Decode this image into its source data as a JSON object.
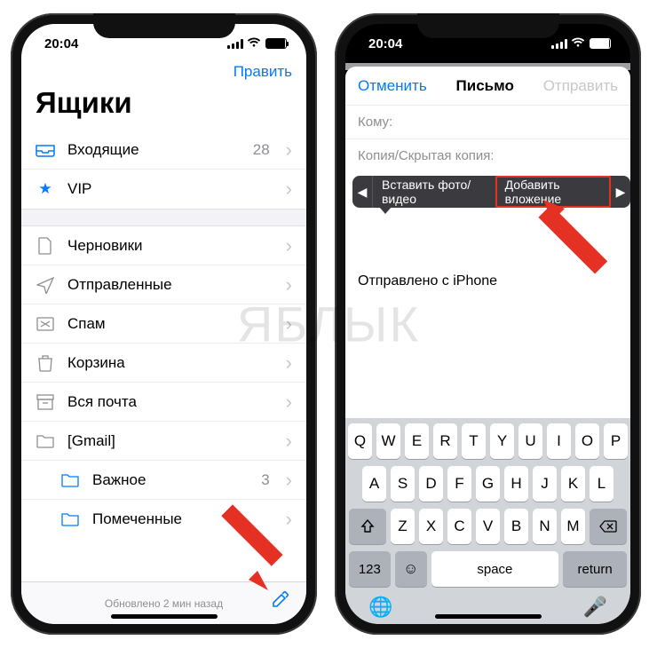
{
  "status": {
    "time": "20:04"
  },
  "left": {
    "edit": "Править",
    "title": "Ящики",
    "inbox": {
      "label": "Входящие",
      "count": "28"
    },
    "vip": {
      "label": "VIP"
    },
    "drafts": {
      "label": "Черновики"
    },
    "sent": {
      "label": "Отправленные"
    },
    "spam": {
      "label": "Спам"
    },
    "trash": {
      "label": "Корзина"
    },
    "allmail": {
      "label": "Вся почта"
    },
    "gmail": {
      "label": "[Gmail]"
    },
    "important": {
      "label": "Важное",
      "count": "3"
    },
    "starred": {
      "label": "Помеченные"
    },
    "updated": "Обновлено 2 мин назад"
  },
  "right": {
    "cancel": "Отменить",
    "title": "Письмо",
    "send": "Отправить",
    "to": "Кому:",
    "cc": "Копия/Скрытая копия:",
    "menu": {
      "insert": "Вставить фото/видео",
      "attach": "Добавить вложение"
    },
    "signature": "Отправлено с iPhone",
    "keys": {
      "r1": [
        "Q",
        "W",
        "E",
        "R",
        "T",
        "Y",
        "U",
        "I",
        "O",
        "P"
      ],
      "r2": [
        "A",
        "S",
        "D",
        "F",
        "G",
        "H",
        "J",
        "K",
        "L"
      ],
      "r3": [
        "Z",
        "X",
        "C",
        "V",
        "B",
        "N",
        "M"
      ],
      "num": "123",
      "space": "space",
      "return": "return"
    }
  },
  "watermark": "ЯБЛЫК"
}
